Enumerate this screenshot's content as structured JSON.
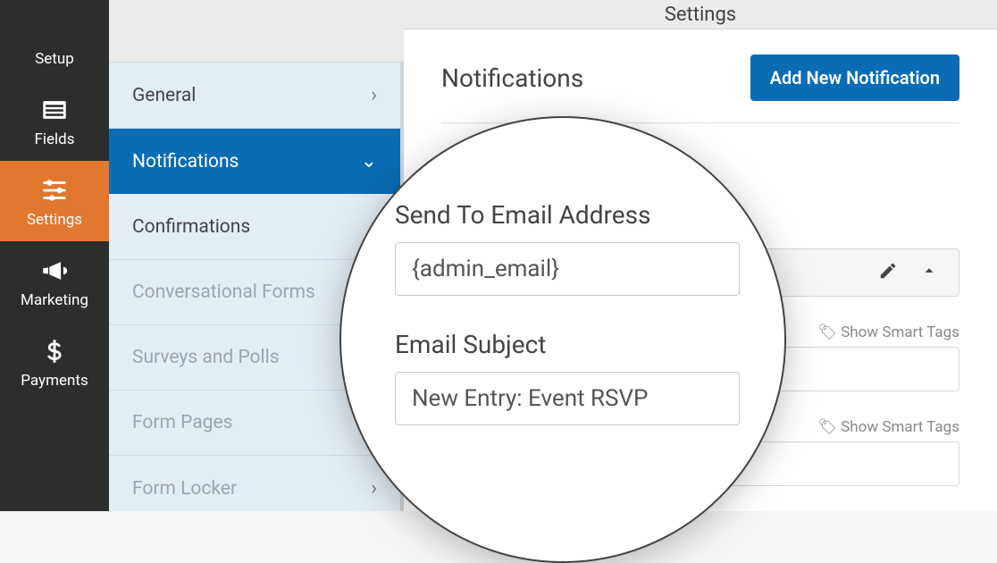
{
  "leftnav": {
    "items": [
      {
        "label": "Setup",
        "icon": "gear"
      },
      {
        "label": "Fields",
        "icon": "list"
      },
      {
        "label": "Settings",
        "icon": "sliders",
        "active": true
      },
      {
        "label": "Marketing",
        "icon": "bullhorn"
      },
      {
        "label": "Payments",
        "icon": "dollar"
      }
    ]
  },
  "header": {
    "title": "Settings"
  },
  "subnav": {
    "items": [
      {
        "label": "General",
        "chev": "right"
      },
      {
        "label": "Notifications",
        "chev": "down",
        "active": true
      },
      {
        "label": "Confirmations",
        "chev": "right"
      },
      {
        "label": "Conversational Forms",
        "dim": true
      },
      {
        "label": "Surveys and Polls",
        "dim": true
      },
      {
        "label": "Form Pages",
        "dim": true
      },
      {
        "label": "Form Locker",
        "chev": "right",
        "dim": true
      }
    ]
  },
  "main": {
    "section_title": "Notifications",
    "add_button": "Add New Notification",
    "smart_tags_label": "Show Smart Tags"
  },
  "zoom": {
    "send_to_label": "Send To Email Address",
    "send_to_value": "{admin_email}",
    "subject_label": "Email Subject",
    "subject_value": "New Entry: Event RSVP"
  }
}
